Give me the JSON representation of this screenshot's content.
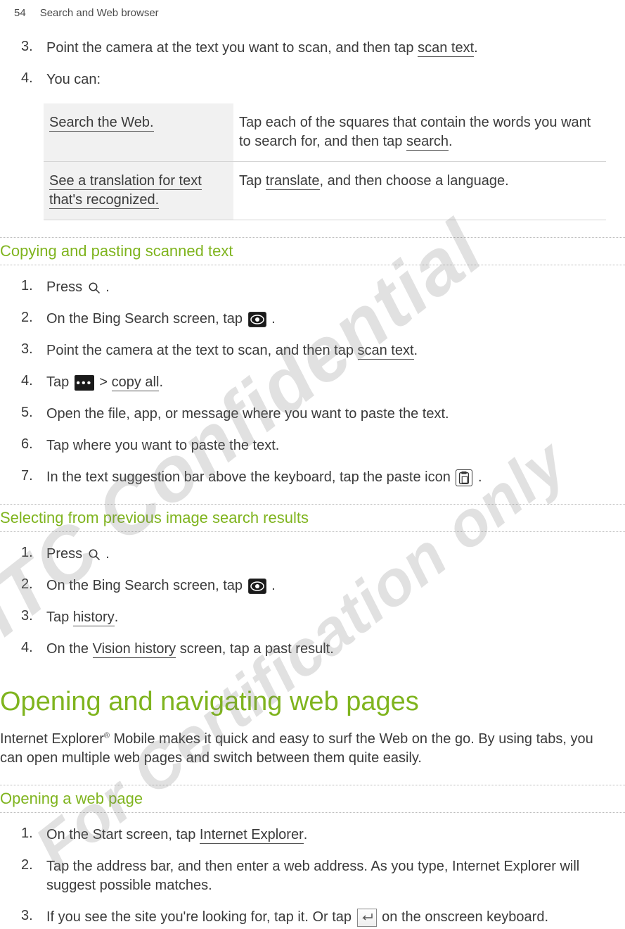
{
  "header": {
    "page_num": "54",
    "section": "Search and Web browser"
  },
  "top_steps": [
    {
      "n": "3.",
      "pre": "Point the camera at the text you want to scan, and then tap ",
      "bold": "scan text",
      "post": "."
    },
    {
      "n": "4.",
      "pre": "You can:",
      "bold": "",
      "post": ""
    }
  ],
  "table": [
    {
      "left": "Search the Web.",
      "right_pre": "Tap each of the squares that contain the words you want to search for, and then tap ",
      "right_bold": "search",
      "right_post": "."
    },
    {
      "left": "See a translation for text that's recognized.",
      "right_pre": "Tap ",
      "right_bold": "translate",
      "right_post": ", and then choose a language."
    }
  ],
  "sec1": {
    "title": "Copying and pasting scanned text"
  },
  "sec1_steps": {
    "s1": {
      "n": "1.",
      "a": "Press ",
      "b": "."
    },
    "s2": {
      "n": "2.",
      "a": "On the Bing Search screen, tap ",
      "b": "."
    },
    "s3": {
      "n": "3.",
      "a": "Point the camera at the text to scan, and then tap ",
      "bold": "scan text",
      "b": "."
    },
    "s4": {
      "n": "4.",
      "a": "Tap ",
      "mid": " > ",
      "bold": "copy all",
      "b": "."
    },
    "s5": {
      "n": "5.",
      "a": "Open the file, app, or message where you want to paste the text."
    },
    "s6": {
      "n": "6.",
      "a": "Tap where you want to paste the text."
    },
    "s7": {
      "n": "7.",
      "a": "In the text suggestion bar above the keyboard, tap the paste icon ",
      "b": "."
    }
  },
  "sec2": {
    "title": "Selecting from previous image search results"
  },
  "sec2_steps": {
    "s1": {
      "n": "1.",
      "a": "Press ",
      "b": "."
    },
    "s2": {
      "n": "2.",
      "a": "On the Bing Search screen, tap ",
      "b": "."
    },
    "s3": {
      "n": "3.",
      "a": "Tap ",
      "bold": "history",
      "b": "."
    },
    "s4": {
      "n": "4.",
      "a": "On the ",
      "bold": "Vision history",
      "b": " screen, tap a past result."
    }
  },
  "h1": "Opening and navigating web pages",
  "intro": {
    "a": "Internet Explorer",
    "reg": "®",
    "b": " Mobile makes it quick and easy to surf the Web on the go. By using tabs, you can open multiple web pages and switch between them quite easily."
  },
  "sec3": {
    "title": "Opening a web page"
  },
  "sec3_steps": {
    "s1": {
      "n": "1.",
      "a": "On the Start screen, tap ",
      "bold": "Internet Explorer",
      "b": "."
    },
    "s2": {
      "n": "2.",
      "a": "Tap the address bar, and then enter a web address. As you type, Internet Explorer will suggest possible matches."
    },
    "s3": {
      "n": "3.",
      "a": "If you see the site you're looking for, tap it. Or tap ",
      "b": " on the onscreen keyboard."
    }
  },
  "watermark": {
    "line1": "HTC Confidential",
    "line2": "For Certification only"
  }
}
